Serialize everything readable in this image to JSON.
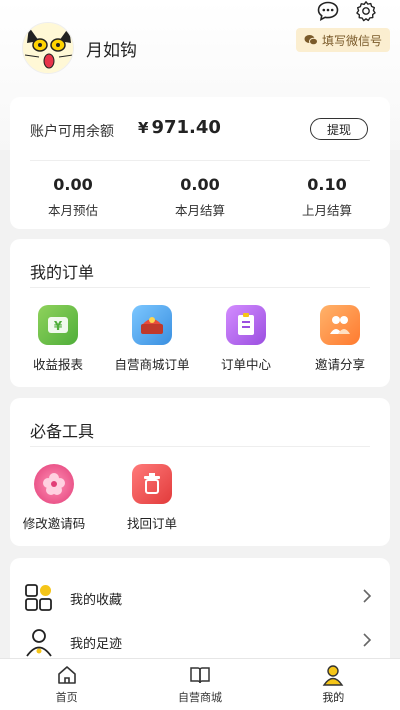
{
  "header": {
    "username": "月如钩",
    "wechat_button": "填写微信号"
  },
  "balance": {
    "label": "账户可用余额",
    "currency": "¥",
    "amount": "971.40",
    "withdraw": "提现",
    "stats": [
      {
        "value": "0.00",
        "label": "本月预估"
      },
      {
        "value": "0.00",
        "label": "本月结算"
      },
      {
        "value": "0.10",
        "label": "上月结算"
      }
    ]
  },
  "orders": {
    "title": "我的订单",
    "items": [
      {
        "label": "收益报表",
        "icon": "income-report-icon"
      },
      {
        "label": "自营商城订单",
        "icon": "mall-orders-icon"
      },
      {
        "label": "订单中心",
        "icon": "order-center-icon"
      },
      {
        "label": "邀请分享",
        "icon": "invite-share-icon"
      }
    ]
  },
  "tools": {
    "title": "必备工具",
    "items": [
      {
        "label": "修改邀请码",
        "icon": "flower-icon"
      },
      {
        "label": "找回订单",
        "icon": "trash-icon"
      }
    ]
  },
  "list": [
    {
      "label": "我的收藏",
      "icon": "favorites-icon"
    },
    {
      "label": "我的足迹",
      "icon": "footprint-icon"
    }
  ],
  "tabbar": [
    {
      "label": "首页",
      "icon": "home-icon"
    },
    {
      "label": "自营商城",
      "icon": "book-icon"
    },
    {
      "label": "我的",
      "icon": "profile-icon"
    }
  ],
  "colors": {
    "accent": "#f5c518",
    "wechat_bg": "#fbeed0",
    "income_icon": "#6cc04a",
    "mall_icon": "#4aa8f0",
    "order_icon": "#b46be6",
    "invite_icon": "#ff8a3d",
    "flower_icon": "#ec4b84",
    "trash_icon": "#e84545"
  }
}
